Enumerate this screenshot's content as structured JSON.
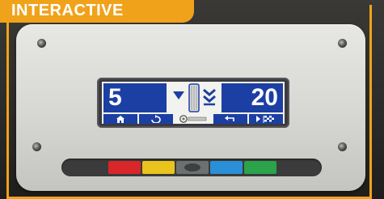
{
  "badge": {
    "text": "INTERACTIVE"
  },
  "display": {
    "left_value": "5",
    "right_value": "20"
  },
  "softkeys": [
    {
      "icon": "home-icon"
    },
    {
      "icon": "rotate-icon"
    },
    {
      "icon": "tire-icon"
    },
    {
      "icon": "back-arrow-icon"
    },
    {
      "icon": "finish-flag-icon"
    }
  ],
  "color_keys": [
    {
      "name": "red",
      "color": "#d8262b"
    },
    {
      "name": "yellow",
      "color": "#e8c41c"
    },
    {
      "name": "gray",
      "color": "#6d7070"
    },
    {
      "name": "blue",
      "color": "#2a8fd6"
    },
    {
      "name": "green",
      "color": "#2aa34a"
    }
  ],
  "colors": {
    "accent": "#f0a21a",
    "lcd_blue": "#1c3fa3"
  }
}
